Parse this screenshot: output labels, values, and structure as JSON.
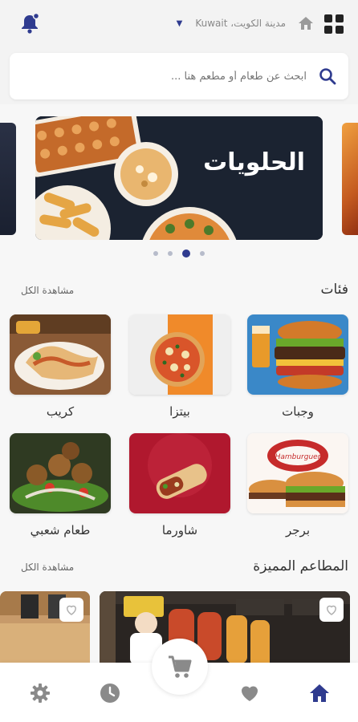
{
  "header": {
    "location": "مدينة الكويت، Kuwait",
    "search_placeholder": "ابحث عن طعام أو مطعم هنا ..."
  },
  "banner": {
    "title": "الحلويات",
    "dots_count": 4,
    "active_dot": 3
  },
  "categories": {
    "title": "فئات",
    "see_all": "مشاهدة الكل",
    "items": [
      {
        "label": "وجبات"
      },
      {
        "label": "بيتزا"
      },
      {
        "label": "كريب"
      },
      {
        "label": "برجر"
      },
      {
        "label": "شاورما"
      },
      {
        "label": "طعام شعبي"
      }
    ]
  },
  "featured": {
    "title": "المطاعم المميزة",
    "see_all": "مشاهدة الكل"
  },
  "colors": {
    "accent": "#2f3b8f",
    "icon_gray": "#8a8a8a"
  }
}
